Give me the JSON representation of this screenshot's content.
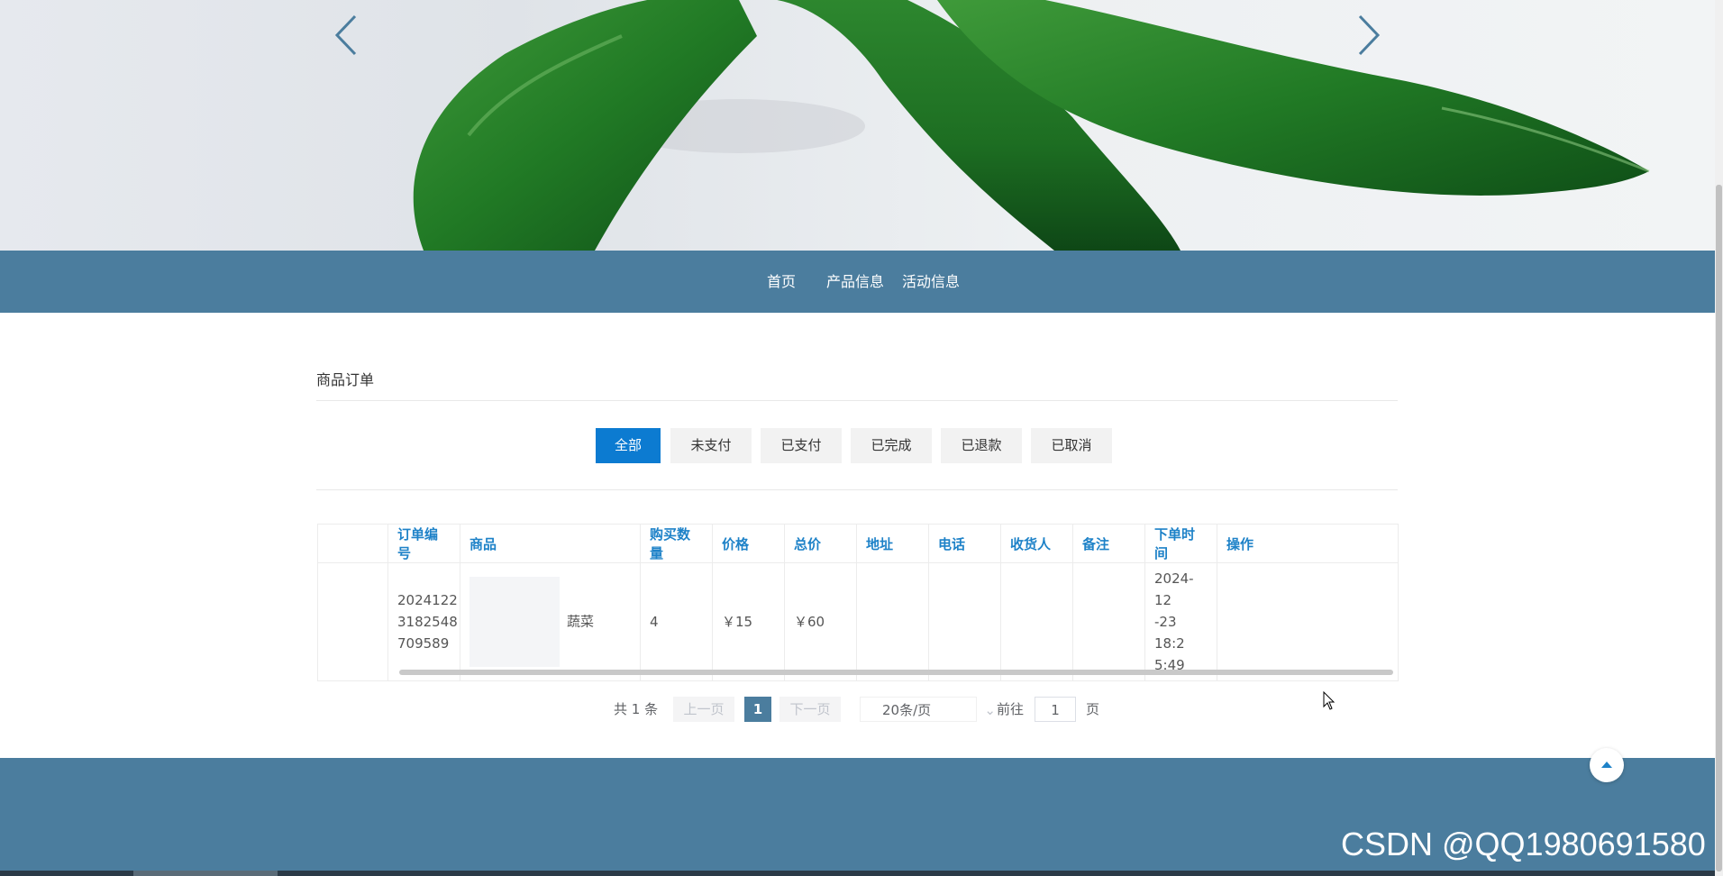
{
  "banner": {
    "prev_icon": "chevron-left-icon",
    "next_icon": "chevron-right-icon"
  },
  "nav": {
    "items": [
      {
        "label": "首页"
      },
      {
        "label": "产品信息"
      },
      {
        "label": "活动信息"
      }
    ]
  },
  "section": {
    "title": "商品订单"
  },
  "tabs": [
    {
      "label": "全部",
      "active": true
    },
    {
      "label": "未支付",
      "active": false
    },
    {
      "label": "已支付",
      "active": false
    },
    {
      "label": "已完成",
      "active": false
    },
    {
      "label": "已退款",
      "active": false
    },
    {
      "label": "已取消",
      "active": false
    }
  ],
  "table": {
    "headers": [
      "",
      "订单编号",
      "商品",
      "购买数量",
      "价格",
      "总价",
      "地址",
      "电话",
      "收货人",
      "备注",
      "下单时间",
      "操作"
    ],
    "rows": [
      {
        "order_no": "2024122\n3182548\n709589",
        "product": "蔬菜",
        "quantity": "4",
        "price": "￥15",
        "total": "￥60",
        "address": "",
        "phone": "",
        "receiver": "",
        "note": "",
        "order_time": "2024-12\n-23 18:2\n5:49",
        "action": ""
      }
    ]
  },
  "pagination": {
    "total": "共 1 条",
    "prev": "上一页",
    "current": "1",
    "next": "下一页",
    "page_size": "20条/页",
    "goto_label": "前往",
    "goto_value": "1",
    "page_suffix": "页"
  },
  "watermark": "CSDN @QQ1980691580",
  "colors": {
    "nav_bg": "#4b7d9e",
    "accent": "#0c7bd1",
    "header_text": "#1e82c8"
  }
}
